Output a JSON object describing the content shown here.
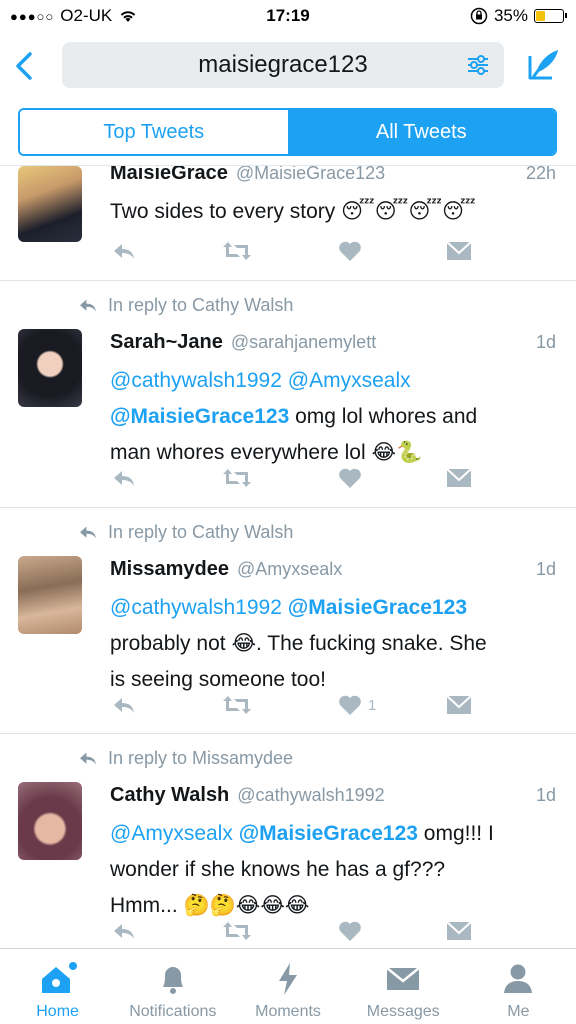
{
  "status_bar": {
    "carrier": "O2-UK",
    "time": "17:19",
    "battery_percent": "35%"
  },
  "search": {
    "query": "maisiegrace123"
  },
  "segments": {
    "top": "Top Tweets",
    "all": "All Tweets",
    "selected": "All Tweets"
  },
  "tweets": [
    {
      "name": "MaisieGrace",
      "handle": "@MaisieGrace123",
      "time": "22h",
      "text": "Two sides to every story",
      "emoji": "😴😴😴😴"
    },
    {
      "reply_to": "In reply to Cathy Walsh",
      "name": "Sarah~Jane",
      "handle": "@sarahjanemylett",
      "time": "1d",
      "mention1": "@cathywalsh1992",
      "mention2": "@Amyxsealx",
      "mention3": "@MaisieGrace123",
      "text1": " omg lol whores and",
      "text2": "man whores everywhere lol",
      "emoji": "😂🐍"
    },
    {
      "reply_to": "In reply to Cathy Walsh",
      "name": "Missamydee",
      "handle": "@Amyxsealx",
      "time": "1d",
      "mention1": "@cathywalsh1992",
      "mention2": "@MaisieGrace123",
      "text1": "probably not",
      "emoji1": "😂",
      "text2": ". The fucking snake. She",
      "text3": "is seeing someone too!",
      "likes": "1"
    },
    {
      "reply_to": "In reply to Missamydee",
      "name": "Cathy Walsh",
      "handle": "@cathywalsh1992",
      "time": "1d",
      "mention1": "@Amyxsealx",
      "mention2": "@MaisieGrace123",
      "text1": " omg!!! I",
      "text2": "wonder if she knows he has a gf???",
      "text3": "Hmm...",
      "emoji": "🤔🤔😂😂😂"
    }
  ],
  "tabs": [
    {
      "label": "Home",
      "icon": "home-icon",
      "active": true
    },
    {
      "label": "Notifications",
      "icon": "bell-icon",
      "active": false
    },
    {
      "label": "Moments",
      "icon": "lightning-icon",
      "active": false
    },
    {
      "label": "Messages",
      "icon": "envelope-icon",
      "active": false
    },
    {
      "label": "Me",
      "icon": "person-icon",
      "active": false
    }
  ],
  "colors": {
    "accent": "#1da1f2",
    "muted": "#8899a6",
    "action_gray": "#aab8c2"
  }
}
